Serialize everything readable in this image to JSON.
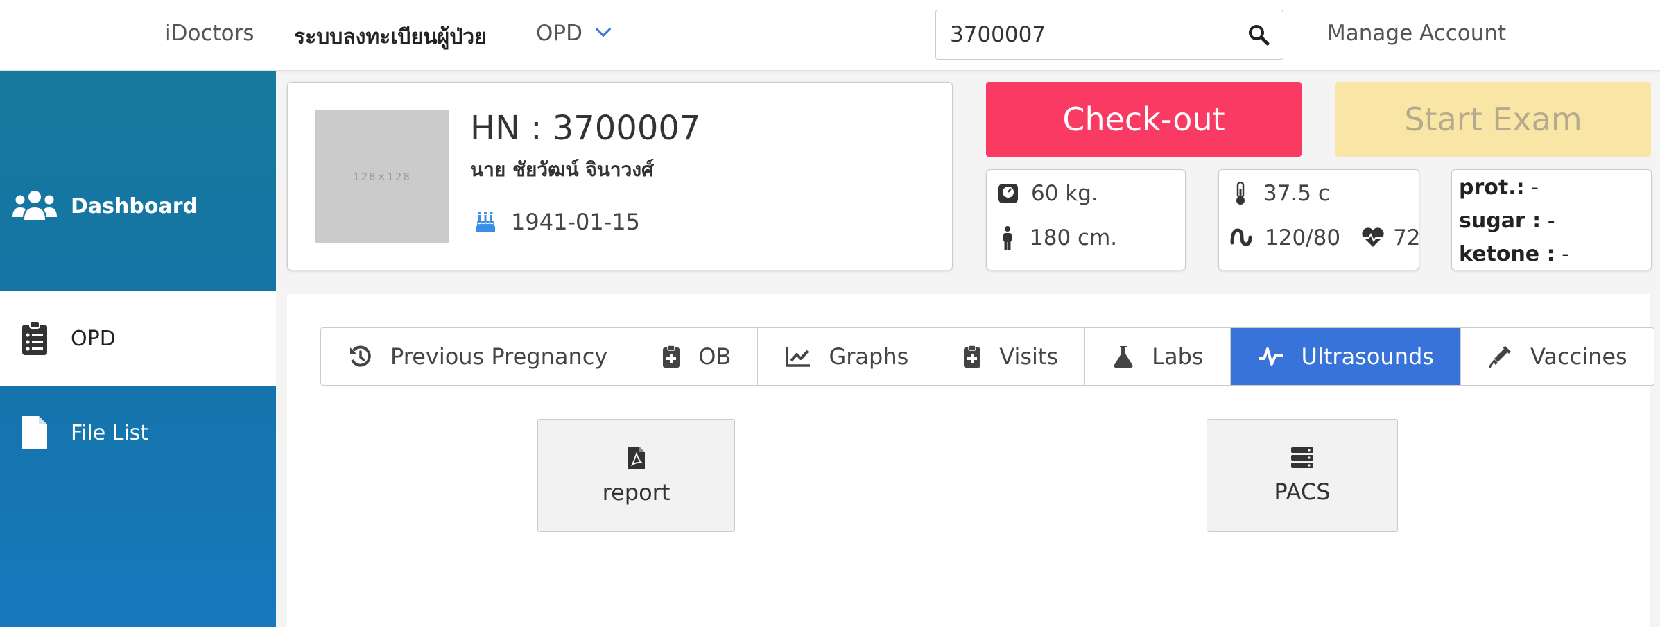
{
  "nav": {
    "brand": "iDoctors",
    "system": "ระบบลงทะเบียนผู้ป่วย",
    "opd": "OPD",
    "search_value": "3700007",
    "account": "Manage Account"
  },
  "sidebar": {
    "items": [
      {
        "label": "Dashboard",
        "icon": "users-icon"
      },
      {
        "label": "OPD",
        "icon": "clipboard-list-icon"
      },
      {
        "label": "File List",
        "icon": "file-icon"
      }
    ]
  },
  "patient": {
    "avatar_text": "128×128",
    "hn": "HN : 3700007",
    "name": "นาย ชัยวัฒน์ จินาวงศ์",
    "dob": "1941-01-15"
  },
  "actions": {
    "checkout": "Check-out",
    "start_exam": "Start Exam"
  },
  "vitals": {
    "weight": "60 kg.",
    "height": "180 cm.",
    "temp": "37.5 c",
    "bp": "120/80",
    "pulse": "72",
    "prot_label": "prot.:",
    "prot_value": "-",
    "sugar_label": "sugar :",
    "sugar_value": "-",
    "ketone_label": "ketone :",
    "ketone_value": "-"
  },
  "tabs": [
    {
      "label": "Previous Pregnancy",
      "icon": "history-icon"
    },
    {
      "label": "OB",
      "icon": "clipboard-plus-icon"
    },
    {
      "label": "Graphs",
      "icon": "chart-line-icon"
    },
    {
      "label": "Visits",
      "icon": "clipboard-plus-icon"
    },
    {
      "label": "Labs",
      "icon": "flask-icon"
    },
    {
      "label": "Ultrasounds",
      "icon": "waveform-icon",
      "active": true
    },
    {
      "label": "Vaccines",
      "icon": "syringe-icon"
    }
  ],
  "tiles": {
    "report": "report",
    "pacs": "PACS"
  },
  "colors": {
    "sidebar_top": "#157a9c",
    "sidebar_bottom": "#1679be",
    "checkout": "#f93a63",
    "start_exam": "#f9e6a7",
    "active_tab": "#3873d9"
  }
}
